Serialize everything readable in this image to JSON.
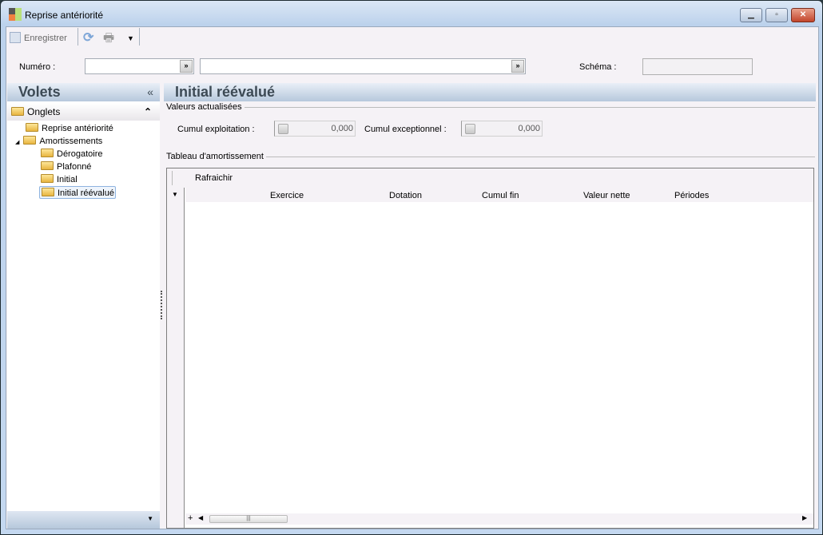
{
  "window": {
    "title": "Reprise antériorité"
  },
  "toolbar": {
    "save_label": "Enregistrer"
  },
  "filters": {
    "numero_label": "Numéro :",
    "numero_value": "",
    "numero_desc": "",
    "schema_label": "Schéma :",
    "schema_value": ""
  },
  "left_panel": {
    "title": "Volets",
    "section": "Onglets",
    "tree": [
      {
        "label": "Reprise antériorité"
      },
      {
        "label": "Amortissements"
      },
      {
        "label": "Dérogatoire"
      },
      {
        "label": "Plafonné"
      },
      {
        "label": "Initial"
      },
      {
        "label": "Initial réévalué"
      }
    ]
  },
  "main": {
    "title": "Initial réévalué",
    "values_group": "Valeurs actualisées",
    "cumul_exploitation_label": "Cumul exploitation :",
    "cumul_exploitation_value": "0,000",
    "cumul_exceptionnel_label": "Cumul exceptionnel :",
    "cumul_exceptionnel_value": "0,000",
    "table_group": "Tableau d'amortissement",
    "refresh_label": "Rafraichir",
    "columns": [
      "Exercice",
      "Dotation",
      "Cumul fin",
      "Valeur nette",
      "Périodes"
    ]
  }
}
